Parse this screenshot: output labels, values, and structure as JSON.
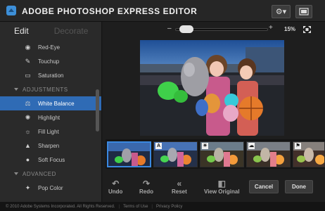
{
  "app": {
    "title": "ADOBE PHOTOSHOP EXPRESS EDITOR",
    "gear_symbol": "⚙▾",
    "fullscreen_symbol": "⛶"
  },
  "tabs": {
    "edit": "Edit",
    "decorate": "Decorate"
  },
  "sidebar": {
    "items_top": [
      {
        "label": "Red-Eye",
        "icon": "eye-icon",
        "glyph": "◉"
      },
      {
        "label": "Touchup",
        "icon": "bandage-icon",
        "glyph": "✎"
      },
      {
        "label": "Saturation",
        "icon": "saturation-icon",
        "glyph": "▭"
      }
    ],
    "section_adjustments": "ADJUSTMENTS",
    "items_adjust": [
      {
        "label": "White Balance",
        "icon": "balance-icon",
        "glyph": "⚖",
        "active": true
      },
      {
        "label": "Highlight",
        "icon": "bulb-icon",
        "glyph": "✺"
      },
      {
        "label": "Fill Light",
        "icon": "fill-light-icon",
        "glyph": "☼"
      },
      {
        "label": "Sharpen",
        "icon": "sharpen-icon",
        "glyph": "▲"
      },
      {
        "label": "Soft Focus",
        "icon": "soft-focus-icon",
        "glyph": "●"
      }
    ],
    "section_advanced": "ADVANCED",
    "items_advanced": [
      {
        "label": "Pop Color",
        "icon": "pop-color-icon",
        "glyph": "✦"
      }
    ]
  },
  "zoom": {
    "minus": "–",
    "plus": "+",
    "percent": "15%",
    "level": 0.05
  },
  "filmstrip": {
    "markers": [
      "",
      "A",
      "☀",
      "☁",
      "⚑"
    ]
  },
  "bottom": {
    "undo": "Undo",
    "redo": "Redo",
    "reset": "Reset",
    "view_original": "View Original",
    "cancel": "Cancel",
    "done": "Done"
  },
  "footer": {
    "copyright": "© 2010 Adobe Systems Incorporated. All Rights Reserved.",
    "terms": "Terms of Use",
    "privacy": "Privacy Policy",
    "separator": "|"
  },
  "colors": {
    "accent": "#2f6bb5",
    "selection": "#3a88e0",
    "background": "#1b1b1b"
  }
}
